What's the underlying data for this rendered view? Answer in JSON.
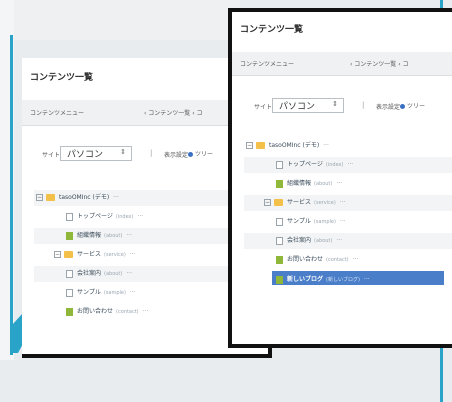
{
  "colors": {
    "accent": "#2aa3c9",
    "selected": "#4a7ec9",
    "folder": "#f3c04a",
    "page_green": "#8fb83b"
  },
  "left": {
    "title": "コンテンツ一覧",
    "menu_label": "コンテンツメニュー",
    "crumb": "‹ コンテンツ一覧 ‹ コ",
    "site_label": "サイト",
    "site_value": "パソコン",
    "chev": "⇕",
    "display_setting": "表示設定",
    "tree_label": "ツリー",
    "nodes": [
      {
        "label": "tasoOMInc (デモ)",
        "tag": "",
        "more": "···",
        "icon": "folder"
      },
      {
        "label": "トップページ",
        "tag": "(index)",
        "more": "···",
        "icon": "page"
      },
      {
        "label": "組織情報",
        "tag": "(about)",
        "more": "···",
        "icon": "green"
      },
      {
        "label": "サービス",
        "tag": "(service)",
        "more": "···",
        "icon": "folder"
      },
      {
        "label": "会社案内",
        "tag": "(about)",
        "more": "···",
        "icon": "page"
      },
      {
        "label": "サンプル",
        "tag": "(sample)",
        "more": "···",
        "icon": "page"
      },
      {
        "label": "お問い合わせ",
        "tag": "(contact)",
        "more": "···",
        "icon": "green"
      }
    ]
  },
  "right": {
    "title": "コンテンツ一覧",
    "menu_label": "コンテンツメニュー",
    "crumb": "‹ コンテンツ一覧 ‹ コ",
    "site_label": "サイト",
    "site_value": "パソコン",
    "chev": "⇕",
    "display_setting": "表示設定",
    "tree_label": "ツリー",
    "nodes": [
      {
        "label": "tasoOMInc (デモ)",
        "tag": "",
        "more": "···",
        "icon": "folder"
      },
      {
        "label": "トップページ",
        "tag": "(index)",
        "more": "···",
        "icon": "page"
      },
      {
        "label": "組織情報",
        "tag": "(about)",
        "more": "···",
        "icon": "green"
      },
      {
        "label": "サービス",
        "tag": "(service)",
        "more": "···",
        "icon": "folder"
      },
      {
        "label": "サンプル",
        "tag": "(sample)",
        "more": "···",
        "icon": "page"
      },
      {
        "label": "会社案内",
        "tag": "(about)",
        "more": "···",
        "icon": "page"
      },
      {
        "label": "お問い合わせ",
        "tag": "(contact)",
        "more": "···",
        "icon": "green"
      },
      {
        "label": "新しいブログ",
        "tag": "(新しいブログ)",
        "more": "···",
        "icon": "green"
      }
    ]
  }
}
